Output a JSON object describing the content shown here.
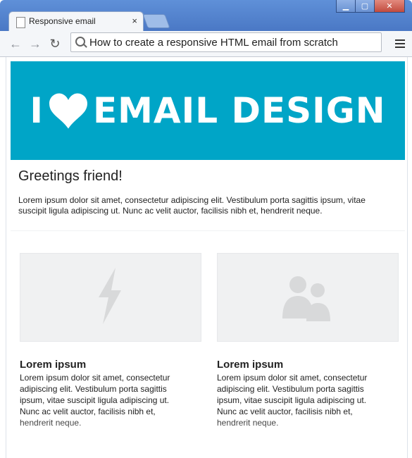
{
  "browser": {
    "tab_title": "Responsive email",
    "address_text": "How to create a responsive HTML email from scratch"
  },
  "email": {
    "banner": {
      "before_heart": "I",
      "after_heart": "EMAIL DESIGN",
      "background": "#00a5c7"
    },
    "greeting": "Greetings friend!",
    "intro": "Lorem ipsum dolor sit amet, consectetur adipiscing elit. Vestibulum porta sagittis ipsum, vitae suscipit ligula adipiscing ut. Nunc ac velit auctor, facilisis nibh et, hendrerit neque.",
    "columns": [
      {
        "icon": "lightning-icon",
        "heading": "Lorem ipsum",
        "body": "Lorem ipsum dolor sit amet, consectetur adipiscing elit. Vestibulum porta sagittis ipsum, vitae suscipit ligula adipiscing ut. Nunc ac velit auctor, facilisis nibh et, hendrerit neque."
      },
      {
        "icon": "users-icon",
        "heading": "Lorem ipsum",
        "body": "Lorem ipsum dolor sit amet, consectetur adipiscing elit. Vestibulum porta sagittis ipsum, vitae suscipit ligula adipiscing ut. Nunc ac velit auctor, facilisis nibh et, hendrerit neque."
      }
    ]
  }
}
